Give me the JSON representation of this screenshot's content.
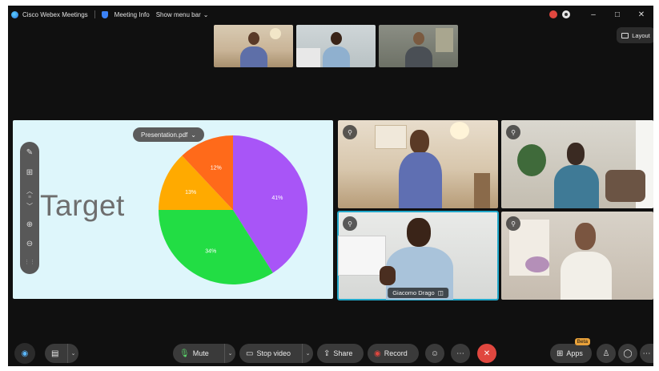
{
  "titlebar": {
    "app_title": "Cisco Webex Meetings",
    "meeting_info": "Meeting Info",
    "show_menu_bar": "Show menu bar",
    "minimize": "–",
    "maximize": "□",
    "close": "✕"
  },
  "layout_button": {
    "label": "Layout"
  },
  "shared_content": {
    "file_pill": "Presentation.pdf",
    "slide_text": "Target",
    "chart_data": {
      "type": "pie",
      "values": [
        41,
        34,
        13,
        12
      ],
      "labels": [
        "41%",
        "34%",
        "13%",
        "12%"
      ],
      "colors": [
        "#a855f7",
        "#22dd44",
        "#ffaa00",
        "#ff6a1a"
      ]
    }
  },
  "tiles": {
    "active_speaker_name": "Giacomo Drago"
  },
  "bottombar": {
    "mute_label": "Mute",
    "stop_video_label": "Stop video",
    "share_label": "Share",
    "record_label": "Record",
    "apps_label": "Apps",
    "beta_badge": "Beta"
  }
}
